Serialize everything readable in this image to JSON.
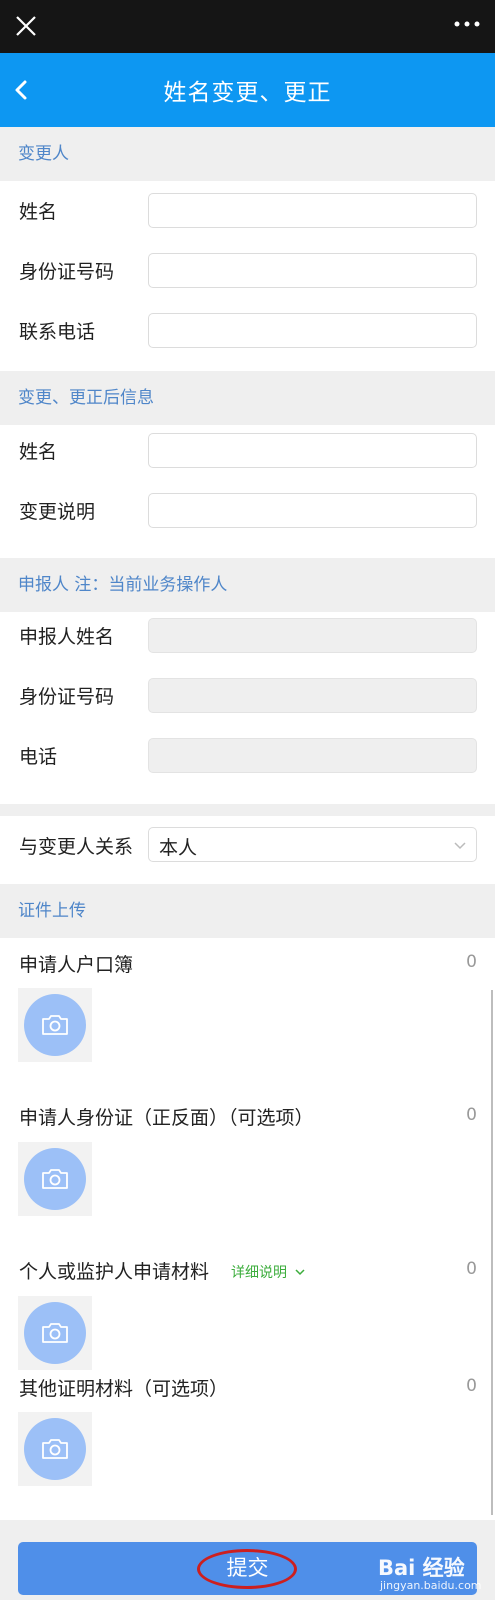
{
  "nav": {
    "title": "姓名变更、更正"
  },
  "sections": {
    "applicant": "变更人",
    "after_change": "变更、更正后信息",
    "declarant": "申报人 注：当前业务操作人",
    "upload": "证件上传"
  },
  "applicant": {
    "name_label": "姓名",
    "id_label": "身份证号码",
    "phone_label": "联系电话",
    "name_value": "",
    "id_value": "",
    "phone_value": ""
  },
  "after_change": {
    "name_label": "姓名",
    "desc_label": "变更说明",
    "name_value": "",
    "desc_value": ""
  },
  "declarant": {
    "name_label": "申报人姓名",
    "id_label": "身份证号码",
    "phone_label": "电话",
    "name_value": "",
    "id_value": "",
    "phone_value": ""
  },
  "relation": {
    "label": "与变更人关系",
    "selected": "本人"
  },
  "uploads": [
    {
      "label": "申请人户口簿",
      "count": "0"
    },
    {
      "label": "申请人身份证（正反面）（可选项）",
      "count": "0"
    },
    {
      "label": "个人或监护人申请材料",
      "count": "0",
      "detail": "详细说明"
    },
    {
      "label": "其他证明材料（可选项）",
      "count": "0"
    }
  ],
  "submit_label": "提交",
  "watermark": {
    "brand": "Bai 经验",
    "url": "jingyan.baidu.com"
  },
  "colors": {
    "nav": "#0d97f2",
    "accent": "#4f86c9",
    "submit": "#4f8fe9",
    "detail": "#3cad3c",
    "annotation_ring": "#cc1f1f"
  }
}
